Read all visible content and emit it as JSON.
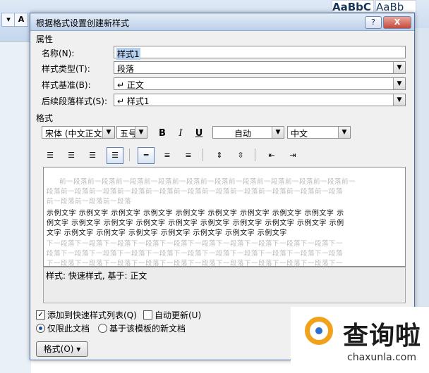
{
  "dialog": {
    "title": "根据格式设置创建新样式",
    "help_label": "?",
    "close_label": "X"
  },
  "properties": {
    "section_label": "属性",
    "name_label": "名称(N):",
    "name_value": "样式1",
    "type_label": "样式类型(T):",
    "type_value": "段落",
    "based_on_label": "样式基准(B):",
    "based_on_value": "↵ 正文",
    "following_label": "后续段落样式(S):",
    "following_value": "↵ 样式1"
  },
  "formatting": {
    "section_label": "格式",
    "font": "宋体 (中文正文",
    "size": "五号",
    "bold": "B",
    "italic": "I",
    "underline": "U",
    "color": "自动",
    "language": "中文"
  },
  "preview": {
    "prev_lines": [
      "前一段落前一段落前一段落前一段落前一段落前一段落前一段落前一段落前一段落前一段落前一",
      "段落前一段落前一段落前一段落前一段落前一段落前一段落前一段落前一段落前一段落前一段落",
      "前一段落前一段落前一段落"
    ],
    "sample_lines": [
      "示例文字 示例文字 示例文字 示例文字 示例文字 示例文字 示例文字 示例文字 示例文字 示",
      "例文字 示例文字 示例文字 示例文字 示例文字 示例文字 示例文字 示例文字 示例文字 示例",
      "文字 示例文字 示例文字 示例文字 示例文字 示例文字 示例文字 示例文字"
    ],
    "next_lines": [
      "下一段落下一段落下一段落下一段落下一段落下一段落下一段落下一段落下一段落下一段落下一",
      "段落下一段落下一段落下一段落下一段落下一段落下一段落下一段落下一段落下一段落下一段落",
      "下一段落下一段落下一段落下一段落下一段落下一段落下一段落下一段落下一段落下一段落下一"
    ]
  },
  "description": "样式: 快速样式, 基于: 正文",
  "options": {
    "add_quick_label": "添加到快速样式列表(Q)",
    "add_quick_checked": true,
    "auto_update_label": "自动更新(U)",
    "auto_update_checked": false,
    "only_doc_label": "仅限此文档",
    "new_docs_label": "基于该模板的新文档"
  },
  "format_button": "格式(O) ▾",
  "background": {
    "ribbon_style_1": "AaBbC",
    "ribbon_style_2": "AaBb"
  },
  "watermark": {
    "cn": "查询啦",
    "en": "chaxunla.com"
  }
}
